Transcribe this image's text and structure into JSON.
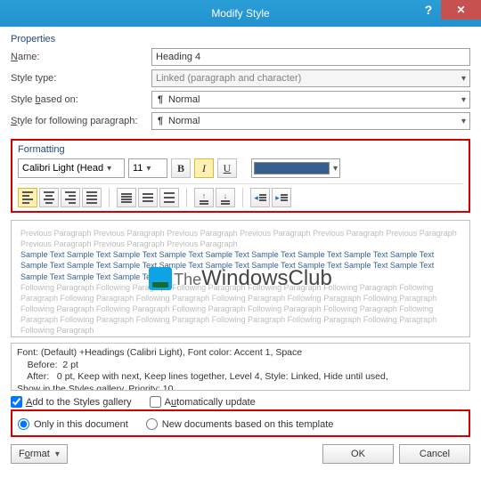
{
  "dialog": {
    "title": "Modify Style"
  },
  "properties": {
    "legend": "Properties",
    "name_label": "Name:",
    "name_value": "Heading 4",
    "type_label": "Style type:",
    "type_value": "Linked (paragraph and character)",
    "based_label": "Style based on:",
    "based_value": "Normal",
    "following_label": "Style for following paragraph:",
    "following_value": "Normal"
  },
  "formatting": {
    "legend": "Formatting",
    "font": "Calibri Light (Head",
    "size": "11",
    "bold": "B",
    "italic": "I",
    "underline": "U"
  },
  "preview": {
    "prev": "Previous Paragraph Previous Paragraph Previous Paragraph Previous Paragraph Previous Paragraph Previous Paragraph Previous Paragraph Previous Paragraph Previous Paragraph",
    "sample": "Sample Text Sample Text Sample Text Sample Text Sample Text Sample Text Sample Text Sample Text Sample Text Sample Text Sample Text Sample Text Sample Text Sample Text Sample Text Sample Text Sample Text Sample Text Sample Text Sample Text Sample Text",
    "next": "Following Paragraph Following Paragraph Following Paragraph Following Paragraph Following Paragraph Following Paragraph Following Paragraph Following Paragraph Following Paragraph Following Paragraph Following Paragraph Following Paragraph Following Paragraph Following Paragraph Following Paragraph Following Paragraph Following Paragraph Following Paragraph Following Paragraph Following Paragraph Following Paragraph Following Paragraph Following Paragraph"
  },
  "watermark": {
    "prefix": "The",
    "name": "WindowsClub"
  },
  "description": {
    "line1": "Font: (Default) +Headings (Calibri Light), Font color: Accent 1, Space",
    "line2": "    Before:  2 pt",
    "line3": "    After:   0 pt, Keep with next, Keep lines together, Level 4, Style: Linked, Hide until used,",
    "line4": "Show in the Styles gallery, Priority: 10"
  },
  "checks": {
    "add_gallery": "Add to the Styles gallery",
    "auto_update": "Automatically update"
  },
  "radios": {
    "only_doc": "Only in this document",
    "new_docs": "New documents based on this template"
  },
  "buttons": {
    "format": "Format",
    "ok": "OK",
    "cancel": "Cancel"
  }
}
